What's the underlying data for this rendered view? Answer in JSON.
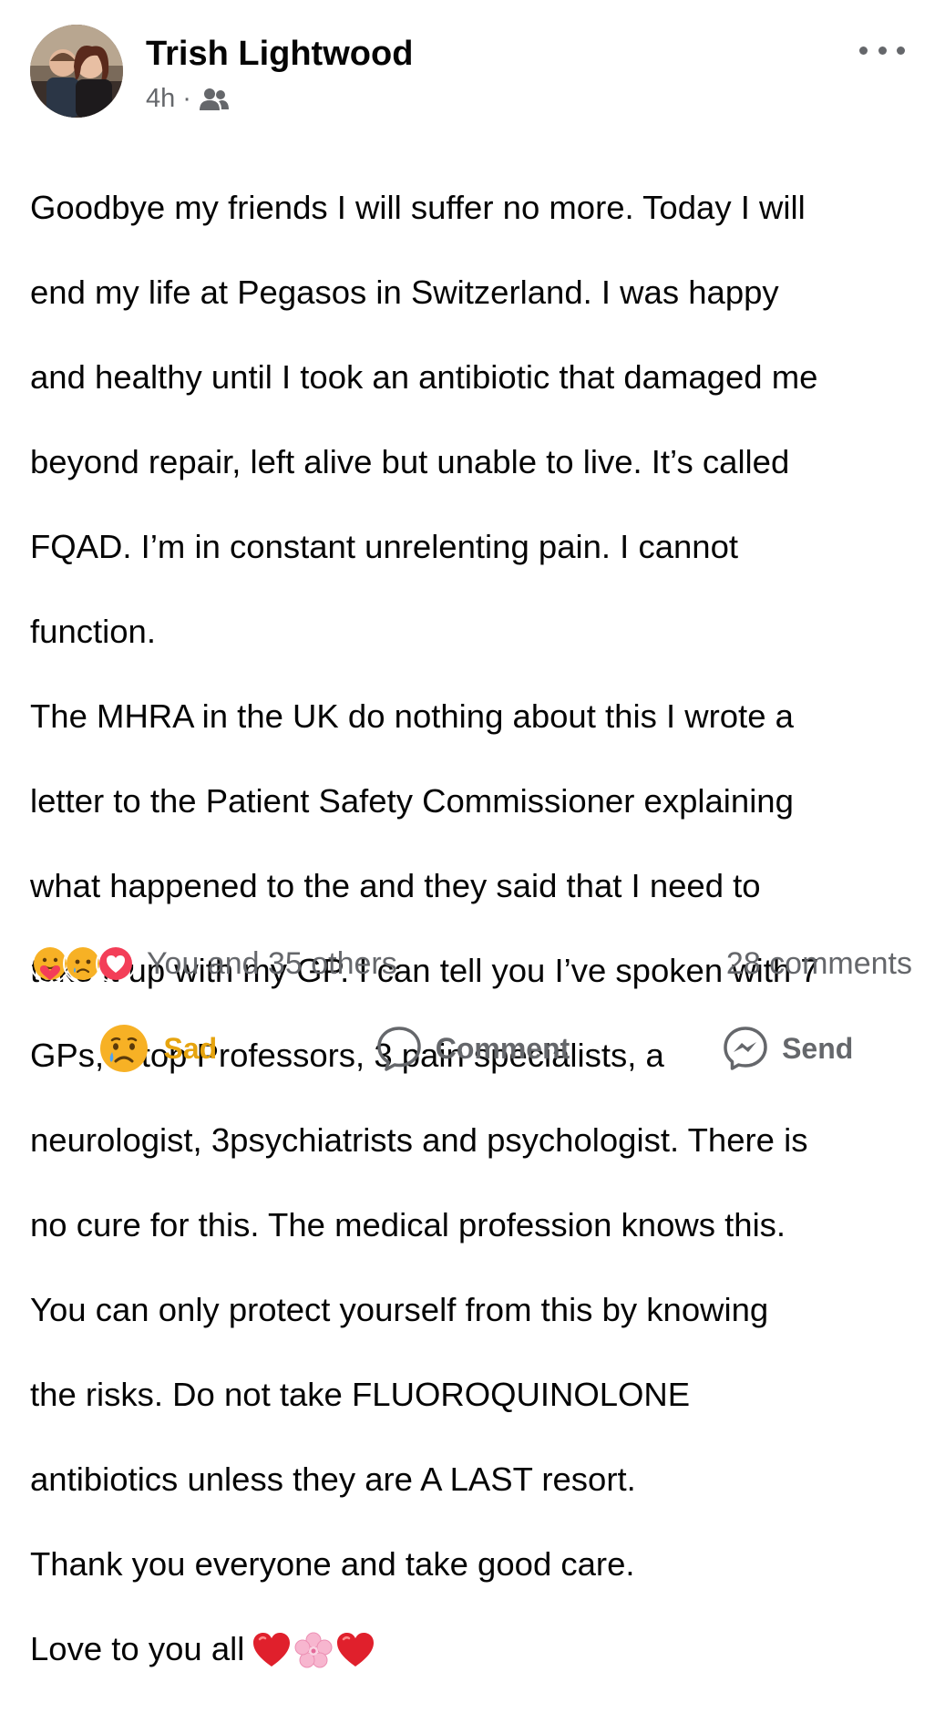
{
  "post": {
    "author": "Trish Lightwood",
    "time": "4h",
    "separator": "·",
    "audience_icon": "friends-icon",
    "text_lines": [
      "Goodbye my friends I will suffer no more. Today I will",
      "end my life at Pegasos in Switzerland. I was happy",
      "and healthy until I took an antibiotic that damaged me",
      "beyond repair, left alive but unable to live. It’s called",
      "FQAD. I’m in constant unrelenting pain. I cannot",
      "function.",
      "The MHRA in the UK do nothing about this I wrote a",
      "letter to the Patient Safety Commissioner explaining",
      "what happened to the and they said that I need to",
      "take it up with my GP. I can tell you I’ve spoken with 7",
      "GPs, 3 top Professors, 3 pain specialists, a",
      "neurologist,  3psychiatrists and psychologist. There is",
      "no cure for this. The medical profession knows this.",
      "You can only protect yourself from this by knowing",
      "the risks. Do not take FLUOROQUINOLONE",
      "antibiotics unless they are A LAST resort.",
      "Thank you everyone and take good care.",
      "Love to you all"
    ],
    "trailing_emojis": [
      "red-heart",
      "cherry-blossom",
      "red-heart"
    ]
  },
  "reactions": {
    "icons": [
      "care-reaction",
      "sad-reaction",
      "love-reaction"
    ],
    "summary": "You and 35 others",
    "comments": "28 comments"
  },
  "actions": {
    "sad_label": "Sad",
    "comment_label": "Comment",
    "send_label": "Send"
  },
  "colors": {
    "meta_gray": "#65676b",
    "love_red": "#f33e58",
    "sad_yellow": "#f7b125",
    "sad_label": "#e6a40f"
  }
}
